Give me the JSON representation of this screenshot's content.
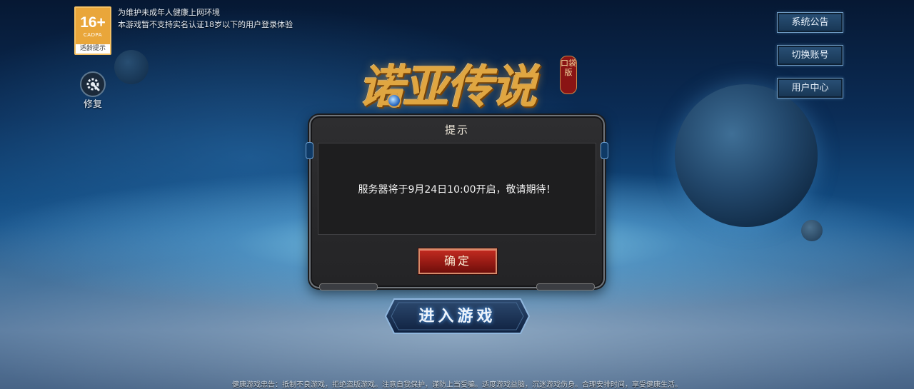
{
  "age_rating": {
    "number": "16+",
    "org": "CADPA",
    "tip": "适龄提示"
  },
  "health_notice": {
    "line1": "为维护未成年人健康上网环境",
    "line2": "本游戏暂不支持实名认证18岁以下的用户登录体验"
  },
  "repair": {
    "label": "修复",
    "icon": "wrench-gear-icon"
  },
  "side_buttons": [
    {
      "label": "系统公告"
    },
    {
      "label": "切换账号"
    },
    {
      "label": "用户中心"
    }
  ],
  "logo": {
    "title": "诺亚传说",
    "edition": "口袋版"
  },
  "dialog": {
    "title": "提示",
    "message": "服务器将于9月24日10:00开启，敬请期待！",
    "confirm": "确定"
  },
  "enter_game": "进入游戏",
  "footer": "健康游戏忠告：抵制不良游戏，拒绝盗版游戏。注意自我保护，谨防上当受骗。适度游戏益脑，沉迷游戏伤身。合理安排时间，享受健康生活。",
  "colors": {
    "accent_gold": "#e0a641",
    "confirm_red": "#c22b20",
    "panel_dark": "#2e2e30",
    "button_blue": "#2a5177"
  }
}
